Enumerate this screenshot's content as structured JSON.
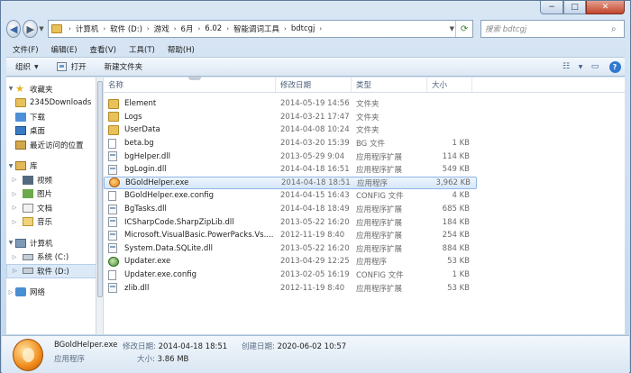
{
  "window": {
    "min_label": "−",
    "max_label": "□",
    "close_label": "✕"
  },
  "address": {
    "back_label": "◀",
    "forward_label": "▶",
    "crumbs": [
      "计算机",
      "软件 (D:)",
      "游戏",
      "6月",
      "6.02",
      "智能调词工具",
      "bdtcgj"
    ],
    "search_placeholder": "搜索 bdtcgj"
  },
  "menu": [
    "文件(F)",
    "编辑(E)",
    "查看(V)",
    "工具(T)",
    "帮助(H)"
  ],
  "toolbar": {
    "organize": "组织",
    "open": "打开",
    "new_folder": "新建文件夹"
  },
  "nav": {
    "favorites": "收藏夹",
    "fav_items": [
      "2345Downloads",
      "下载",
      "桌面",
      "最近访问的位置"
    ],
    "libraries": "库",
    "lib_items": [
      "视频",
      "图片",
      "文档",
      "音乐"
    ],
    "computer": "计算机",
    "drives": [
      "系统 (C:)",
      "软件 (D:)"
    ],
    "network": "网络"
  },
  "columns": {
    "name": "名称",
    "date": "修改日期",
    "type": "类型",
    "size": "大小"
  },
  "files": [
    {
      "name": "Element",
      "date": "2014-05-19 14:56",
      "type": "文件夹",
      "size": "",
      "icon": "folder"
    },
    {
      "name": "Logs",
      "date": "2014-03-21 17:47",
      "type": "文件夹",
      "size": "",
      "icon": "folder"
    },
    {
      "name": "UserData",
      "date": "2014-04-08 10:24",
      "type": "文件夹",
      "size": "",
      "icon": "folder"
    },
    {
      "name": "beta.bg",
      "date": "2014-03-20 15:39",
      "type": "BG 文件",
      "size": "1 KB",
      "icon": "file"
    },
    {
      "name": "bgHelper.dll",
      "date": "2013-05-29 9:04",
      "type": "应用程序扩展",
      "size": "114 KB",
      "icon": "dll"
    },
    {
      "name": "bgLogin.dll",
      "date": "2014-04-18 16:51",
      "type": "应用程序扩展",
      "size": "549 KB",
      "icon": "dll"
    },
    {
      "name": "BGoldHelper.exe",
      "date": "2014-04-18 18:51",
      "type": "应用程序",
      "size": "3,962 KB",
      "icon": "app",
      "selected": true
    },
    {
      "name": "BGoldHelper.exe.config",
      "date": "2014-04-15 16:43",
      "type": "CONFIG 文件",
      "size": "4 KB",
      "icon": "cfg"
    },
    {
      "name": "BgTasks.dll",
      "date": "2014-04-18 18:49",
      "type": "应用程序扩展",
      "size": "685 KB",
      "icon": "dll"
    },
    {
      "name": "ICSharpCode.SharpZipLib.dll",
      "date": "2013-05-22 16:20",
      "type": "应用程序扩展",
      "size": "184 KB",
      "icon": "dll"
    },
    {
      "name": "Microsoft.VisualBasic.PowerPacks.Vs....",
      "date": "2012-11-19 8:40",
      "type": "应用程序扩展",
      "size": "254 KB",
      "icon": "dll"
    },
    {
      "name": "System.Data.SQLite.dll",
      "date": "2013-05-22 16:20",
      "type": "应用程序扩展",
      "size": "884 KB",
      "icon": "dll"
    },
    {
      "name": "Updater.exe",
      "date": "2013-04-29 12:25",
      "type": "应用程序",
      "size": "53 KB",
      "icon": "upd"
    },
    {
      "name": "Updater.exe.config",
      "date": "2013-02-05 16:19",
      "type": "CONFIG 文件",
      "size": "1 KB",
      "icon": "cfg"
    },
    {
      "name": "zlib.dll",
      "date": "2012-11-19 8:40",
      "type": "应用程序扩展",
      "size": "53 KB",
      "icon": "dll"
    }
  ],
  "details": {
    "name": "BGoldHelper.exe",
    "modified_label": "修改日期:",
    "modified": "2014-04-18 18:51",
    "created_label": "创建日期:",
    "created": "2020-06-02 10:57",
    "type": "应用程序",
    "size_label": "大小:",
    "size": "3.86 MB"
  }
}
